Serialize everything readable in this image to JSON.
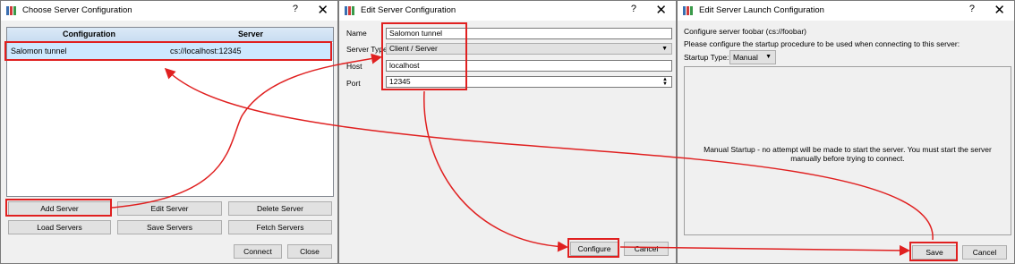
{
  "dialog1": {
    "title": "Choose Server Configuration",
    "help": "?",
    "close": "✕",
    "columns": [
      "Configuration",
      "Server"
    ],
    "rows": [
      {
        "config": "Salomon tunnel",
        "server": "cs://localhost:12345"
      }
    ],
    "buttons": {
      "add": "Add Server",
      "edit": "Edit Server",
      "delete": "Delete Server",
      "load": "Load Servers",
      "save": "Save Servers",
      "fetch": "Fetch Servers",
      "connect": "Connect",
      "close": "Close"
    }
  },
  "dialog2": {
    "title": "Edit Server Configuration",
    "help": "?",
    "close": "✕",
    "fields": {
      "name_label": "Name",
      "name_value": "Salomon tunnel",
      "type_label": "Server Type",
      "type_value": "Client / Server",
      "host_label": "Host",
      "host_value": "localhost",
      "port_label": "Port",
      "port_value": "12345"
    },
    "buttons": {
      "configure": "Configure",
      "cancel": "Cancel"
    }
  },
  "dialog3": {
    "title": "Edit Server Launch Configuration",
    "help": "?",
    "close": "✕",
    "line1": "Configure server foobar (cs://foobar)",
    "line2": "Please configure the startup procedure to be used when connecting to this server:",
    "startup_label": "Startup Type:",
    "startup_value": "Manual",
    "manual_text": "Manual Startup - no attempt will be made to start the server.  You must start the server manually before trying to connect.",
    "buttons": {
      "save": "Save",
      "cancel": "Cancel"
    }
  },
  "colors": {
    "highlight": "#e02020",
    "selection": "#cde8ff",
    "header": "#c9ddf1"
  }
}
